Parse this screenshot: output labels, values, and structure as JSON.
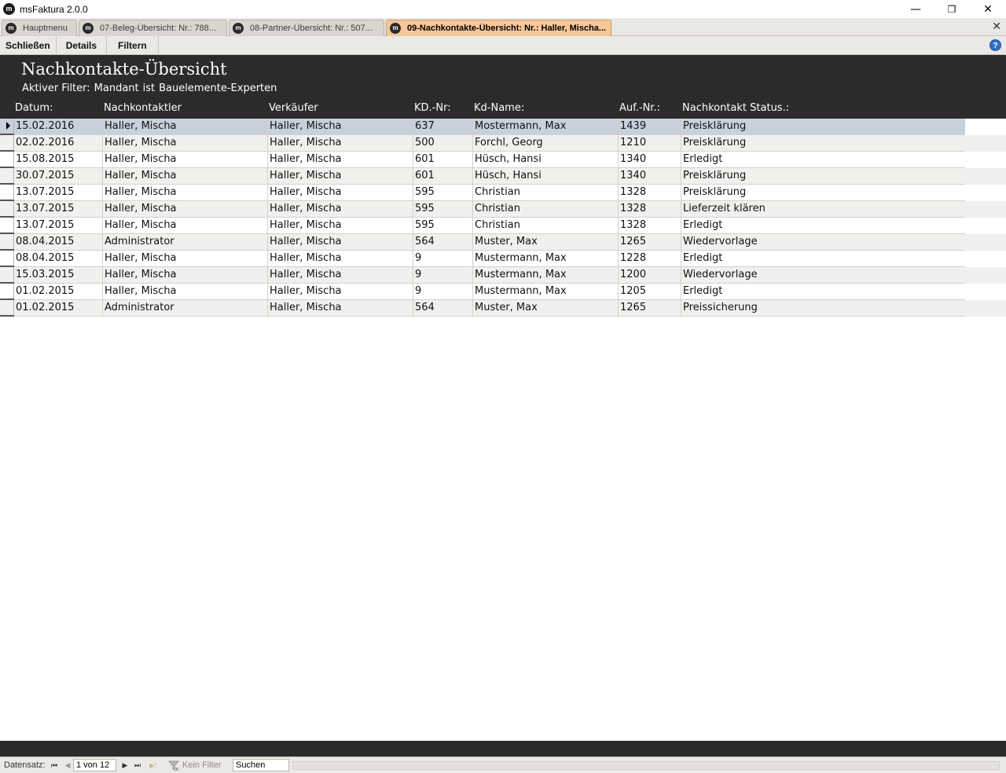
{
  "window": {
    "title": "msFaktura 2.0.0",
    "icon": "m",
    "minimize_icon": "—",
    "restore_icon": "❐",
    "close_icon": "✕"
  },
  "tabs": [
    {
      "label": "Hauptmenu",
      "active": false
    },
    {
      "label": "07-Beleg-Übersicht: Nr.: 788...",
      "active": false
    },
    {
      "label": "08-Partner-Übersicht: Nr.: 507...",
      "active": false
    },
    {
      "label": "09-Nachkontakte-Übersicht: Nr.: Haller, Mischa...",
      "active": true
    }
  ],
  "tab_close_icon": "✕",
  "toolbar": {
    "close_label": "Schließen",
    "details_label": "Details",
    "filter_label": "Filtern",
    "help_icon": "?"
  },
  "header": {
    "title": "Nachkontakte-Übersicht",
    "filter_prefix": "Aktiver Filter:",
    "filter_field": "Mandant",
    "filter_op": "ist",
    "filter_value": "Bauelemente-Experten"
  },
  "columns": {
    "datum": "Datum:",
    "nachkontaktler": "Nachkontaktler",
    "verkaeufer": "Verkäufer",
    "kdnr": "KD.-Nr:",
    "kdname": "Kd-Name:",
    "aufnr": "Auf.-Nr.:",
    "status": "Nachkontakt Status.:"
  },
  "rows": [
    {
      "datum": "15.02.2016",
      "nachkontaktler": "Haller, Mischa",
      "verkaeufer": "Haller, Mischa",
      "kdnr": "637",
      "kdname": "Mostermann, Max",
      "aufnr": "1439",
      "status": "Preisklärung"
    },
    {
      "datum": "02.02.2016",
      "nachkontaktler": "Haller, Mischa",
      "verkaeufer": "Haller, Mischa",
      "kdnr": "500",
      "kdname": "Forchl, Georg",
      "aufnr": "1210",
      "status": "Preisklärung"
    },
    {
      "datum": "15.08.2015",
      "nachkontaktler": "Haller, Mischa",
      "verkaeufer": "Haller, Mischa",
      "kdnr": "601",
      "kdname": "Hüsch, Hansi",
      "aufnr": "1340",
      "status": "Erledigt"
    },
    {
      "datum": "30.07.2015",
      "nachkontaktler": "Haller, Mischa",
      "verkaeufer": "Haller, Mischa",
      "kdnr": "601",
      "kdname": "Hüsch, Hansi",
      "aufnr": "1340",
      "status": "Preisklärung"
    },
    {
      "datum": "13.07.2015",
      "nachkontaktler": "Haller, Mischa",
      "verkaeufer": "Haller, Mischa",
      "kdnr": "595",
      "kdname": "Christian",
      "aufnr": "1328",
      "status": "Preisklärung"
    },
    {
      "datum": "13.07.2015",
      "nachkontaktler": "Haller, Mischa",
      "verkaeufer": "Haller, Mischa",
      "kdnr": "595",
      "kdname": "Christian",
      "aufnr": "1328",
      "status": "Lieferzeit klären"
    },
    {
      "datum": "13.07.2015",
      "nachkontaktler": "Haller, Mischa",
      "verkaeufer": "Haller, Mischa",
      "kdnr": "595",
      "kdname": "Christian",
      "aufnr": "1328",
      "status": "Erledigt"
    },
    {
      "datum": "08.04.2015",
      "nachkontaktler": "Administrator",
      "verkaeufer": "Haller, Mischa",
      "kdnr": "564",
      "kdname": "Muster, Max",
      "aufnr": "1265",
      "status": "Wiedervorlage"
    },
    {
      "datum": "08.04.2015",
      "nachkontaktler": "Haller, Mischa",
      "verkaeufer": "Haller, Mischa",
      "kdnr": "9",
      "kdname": "Mustermann, Max",
      "aufnr": "1228",
      "status": "Erledigt"
    },
    {
      "datum": "15.03.2015",
      "nachkontaktler": "Haller, Mischa",
      "verkaeufer": "Haller, Mischa",
      "kdnr": "9",
      "kdname": "Mustermann, Max",
      "aufnr": "1200",
      "status": "Wiedervorlage"
    },
    {
      "datum": "01.02.2015",
      "nachkontaktler": "Haller, Mischa",
      "verkaeufer": "Haller, Mischa",
      "kdnr": "9",
      "kdname": "Mustermann, Max",
      "aufnr": "1205",
      "status": "Erledigt"
    },
    {
      "datum": "01.02.2015",
      "nachkontaktler": "Administrator",
      "verkaeufer": "Haller, Mischa",
      "kdnr": "564",
      "kdname": "Muster, Max",
      "aufnr": "1265",
      "status": "Preissicherung"
    }
  ],
  "selected_row": 0,
  "navbar": {
    "record_label": "Datensatz:",
    "first_icon": "⏮",
    "prev_icon": "◀",
    "position": "1 von 12",
    "next_icon": "▶",
    "last_icon": "⏭",
    "new_icon": "▶*",
    "filter_status": "Kein Filter",
    "search_label": "Suchen"
  },
  "colors": {
    "header_bg": "#2b2b2b",
    "active_tab": "#f7c79a",
    "selected_row": "#c8d0dc",
    "alt_row": "#f1f0ee"
  }
}
